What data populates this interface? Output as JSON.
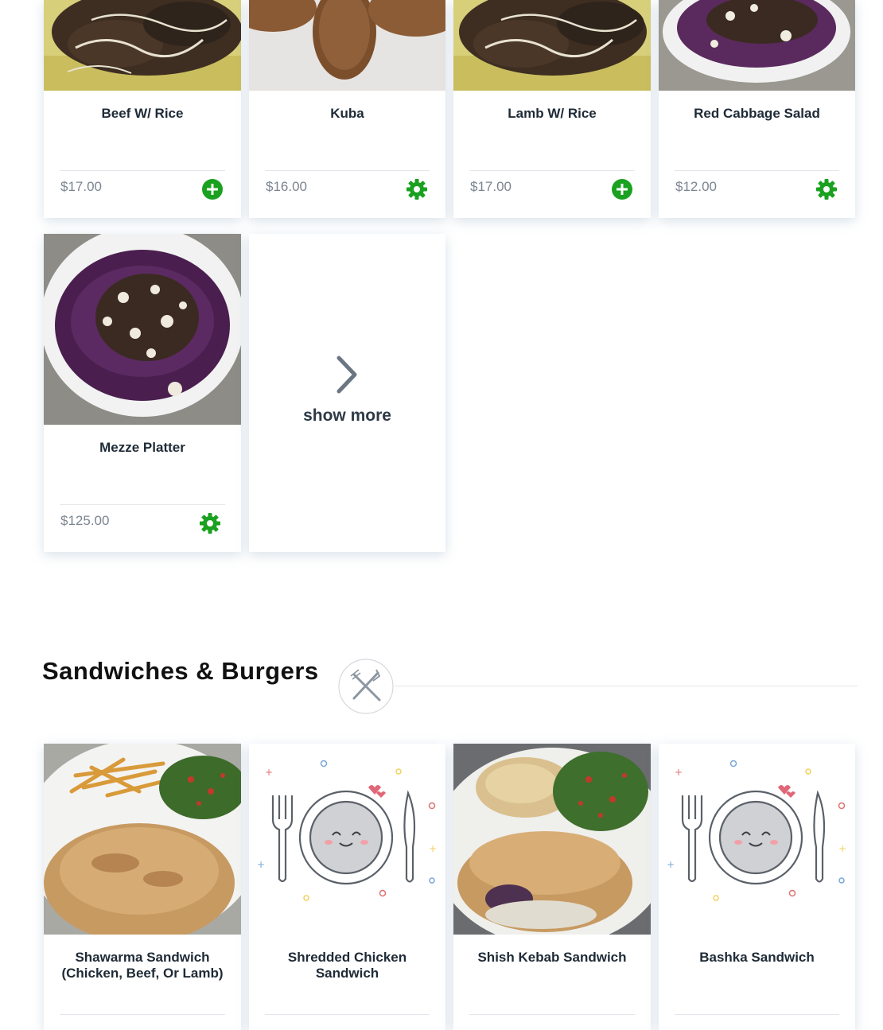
{
  "top_row": [
    {
      "name": "Beef W/ Rice",
      "price": "$17.00",
      "action": "add-icon"
    },
    {
      "name": "Kuba",
      "price": "$16.00",
      "action": "gear-icon"
    },
    {
      "name": "Lamb W/ Rice",
      "price": "$17.00",
      "action": "add-icon"
    },
    {
      "name": "Red Cabbage Salad",
      "price": "$12.00",
      "action": "gear-icon"
    }
  ],
  "second_row": [
    {
      "name": "Mezze Platter",
      "price": "$125.00",
      "action": "gear-icon"
    }
  ],
  "show_more": {
    "label": "show more",
    "icon": "chevron-right-icon"
  },
  "section": {
    "title": "Sandwiches & Burgers",
    "icon": "fork-knife-icon"
  },
  "sandwiches": [
    {
      "name_line1": "Shawarma Sandwich",
      "name_line2": "(Chicken, Beef, Or Lamb)"
    },
    {
      "name_line1": "Shredded Chicken",
      "name_line2": "Sandwich"
    },
    {
      "name_line1": "Shish Kebab Sandwich",
      "name_line2": ""
    },
    {
      "name_line1": "Bashka Sandwich",
      "name_line2": ""
    }
  ],
  "colors": {
    "accent_green": "#1aa11f",
    "price_gray": "#7b8590",
    "title": "#1e2a36"
  }
}
